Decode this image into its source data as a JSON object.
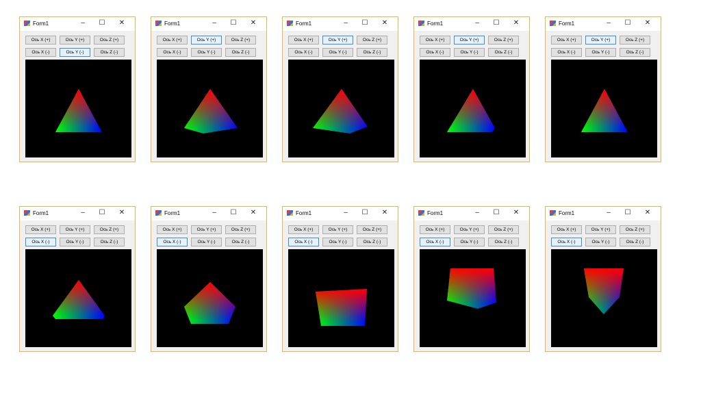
{
  "windows": [
    {
      "title": "Form1",
      "focused": "y_minus"
    },
    {
      "title": "Form1",
      "focused": "y_plus"
    },
    {
      "title": "Form1",
      "focused": "y_plus"
    },
    {
      "title": "Form1",
      "focused": "y_plus"
    },
    {
      "title": "Form1",
      "focused": "y_plus"
    },
    {
      "title": "Form1",
      "focused": "x_minus"
    },
    {
      "title": "Form1",
      "focused": "x_minus"
    },
    {
      "title": "Form1",
      "focused": "x_minus"
    },
    {
      "title": "Form1",
      "focused": "x_minus"
    },
    {
      "title": "Form1",
      "focused": "x_minus"
    }
  ],
  "buttons": {
    "x_plus": "Ось X (+)",
    "y_plus": "Ось Y (+)",
    "z_plus": "Ось Z (+)",
    "x_minus": "Ось X (-)",
    "y_minus": "Ось Y (-)",
    "z_minus": "Ось Z (-)"
  },
  "controls": {
    "minimize": "–",
    "maximize": "☐",
    "close": "✕"
  }
}
